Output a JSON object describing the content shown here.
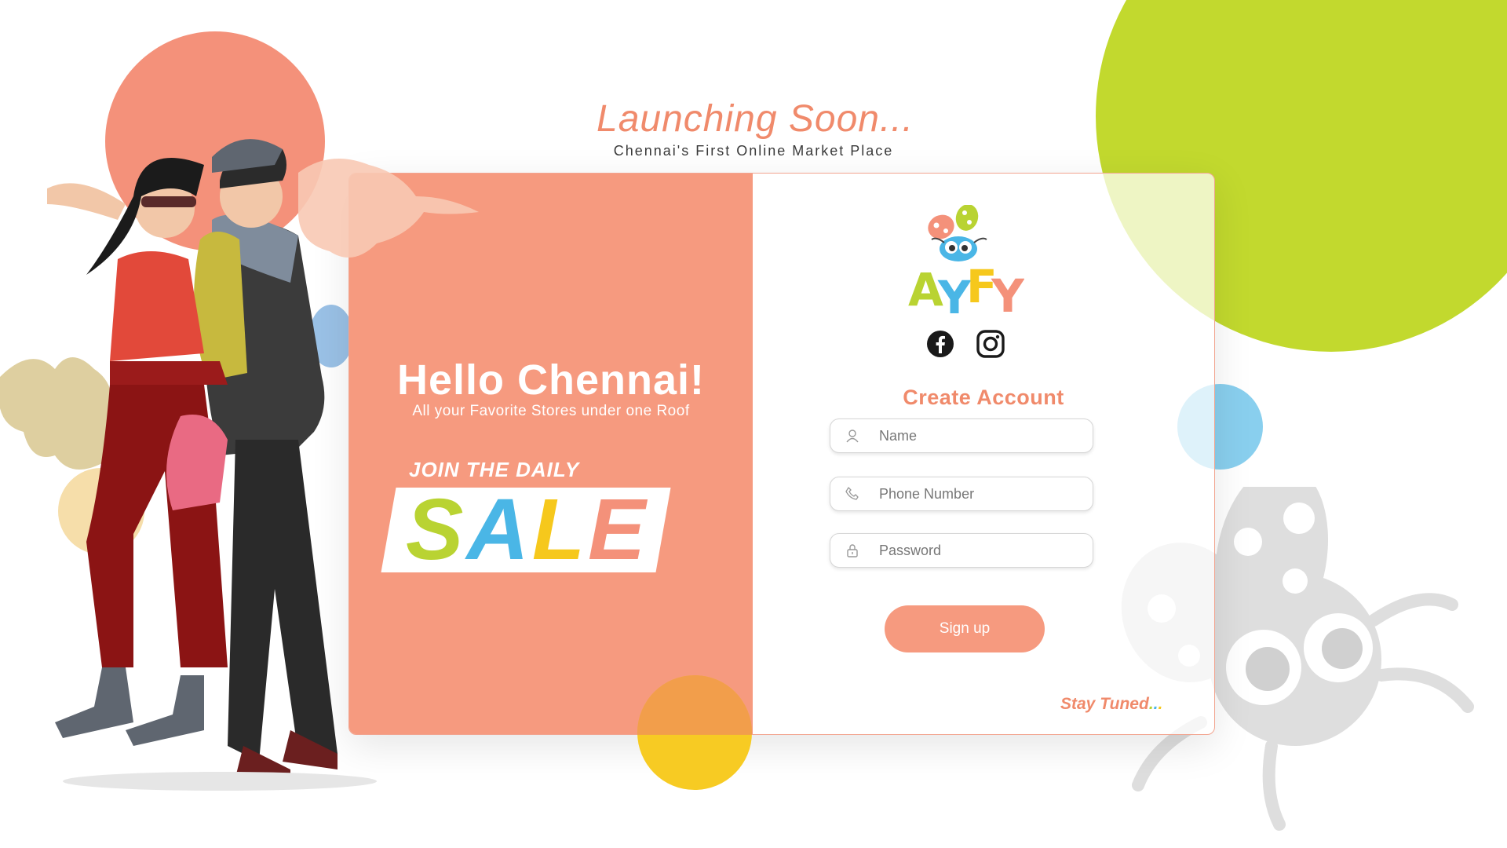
{
  "header": {
    "title": "Launching Soon...",
    "subtitle": "Chennai's First Online Market Place"
  },
  "promo": {
    "hello": "Hello Chennai!",
    "tagline": "All your Favorite Stores under one Roof",
    "join": "JOIN THE DAILY",
    "sale_letters": [
      "S",
      "A",
      "L",
      "E"
    ]
  },
  "brand": {
    "logo_letters": [
      "A",
      "Y",
      "F",
      "Y"
    ],
    "logo_colors": [
      "#b9d332",
      "#4ab6e6",
      "#f6c81c",
      "#f4917a"
    ]
  },
  "social": {
    "facebook_icon": "facebook-icon",
    "instagram_icon": "instagram-icon"
  },
  "form": {
    "title": "Create Account",
    "name_placeholder": "Name",
    "phone_placeholder": "Phone Number",
    "password_placeholder": "Password",
    "signup_label": "Sign up"
  },
  "footer": {
    "stay_tuned": "Stay Tuned",
    "dots": [
      ".",
      ".",
      "."
    ]
  },
  "colors": {
    "accent": "#f69a7f",
    "accent_text": "#f08a6b",
    "green": "#c2d92e",
    "blue": "#4ab6e6",
    "yellow": "#f6c81c"
  }
}
